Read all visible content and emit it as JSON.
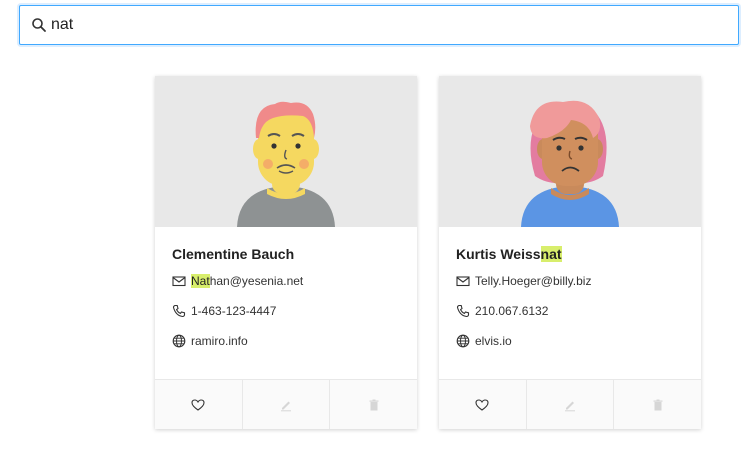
{
  "search": {
    "value": "nat",
    "icon": "search-icon"
  },
  "cards": [
    {
      "name_prefix": "Clementine Bauch",
      "name_match": "",
      "email_match": "Nat",
      "email_rest": "han@yesenia.net",
      "phone": "1-463-123-4447",
      "website": "ramiro.info"
    },
    {
      "name_prefix": "Kurtis Weiss",
      "name_match": "nat",
      "email_match": "",
      "email_rest": "Telly.Hoeger@billy.biz",
      "phone": "210.067.6132",
      "website": "elvis.io"
    }
  ],
  "colors": {
    "highlight": "#d8ee6c",
    "focus_border": "#40a9ff",
    "avatar_bg": "#e8e8e8"
  }
}
